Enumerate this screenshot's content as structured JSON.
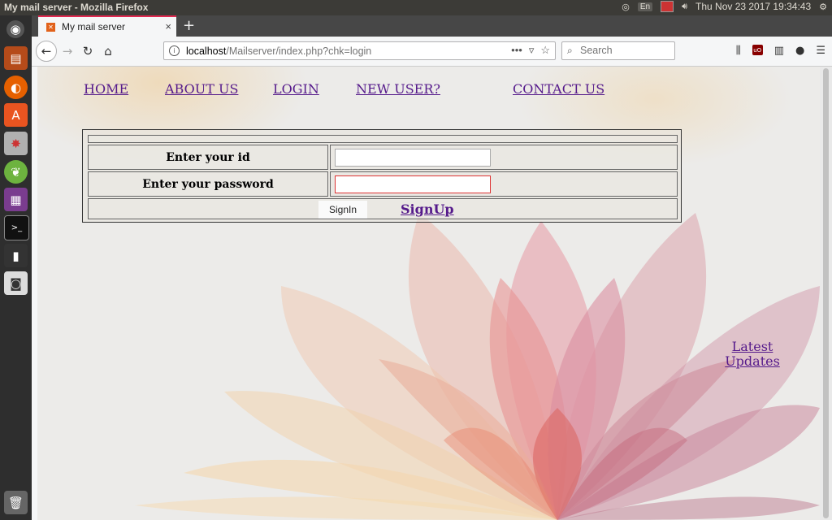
{
  "panel": {
    "window_title": "My mail server - Mozilla Firefox",
    "lang": "En",
    "datetime": "Thu Nov 23 2017 19:34:43"
  },
  "browser": {
    "tab_title": "My mail server",
    "url_host": "localhost",
    "url_path": "/Mailserver/index.php?chk=login",
    "search_placeholder": "Search"
  },
  "site_nav": {
    "home": "HOME",
    "about": "ABOUT US",
    "login": "LOGIN",
    "new_user": "NEW USER?",
    "contact": "CONTACT US"
  },
  "login_form": {
    "id_label": "Enter your id",
    "password_label": "Enter your password",
    "id_value": "",
    "password_value": "",
    "signin_label": "SignIn",
    "signup_label": "SignUp"
  },
  "latest_updates": {
    "line1": "Latest",
    "line2": "Updates"
  }
}
